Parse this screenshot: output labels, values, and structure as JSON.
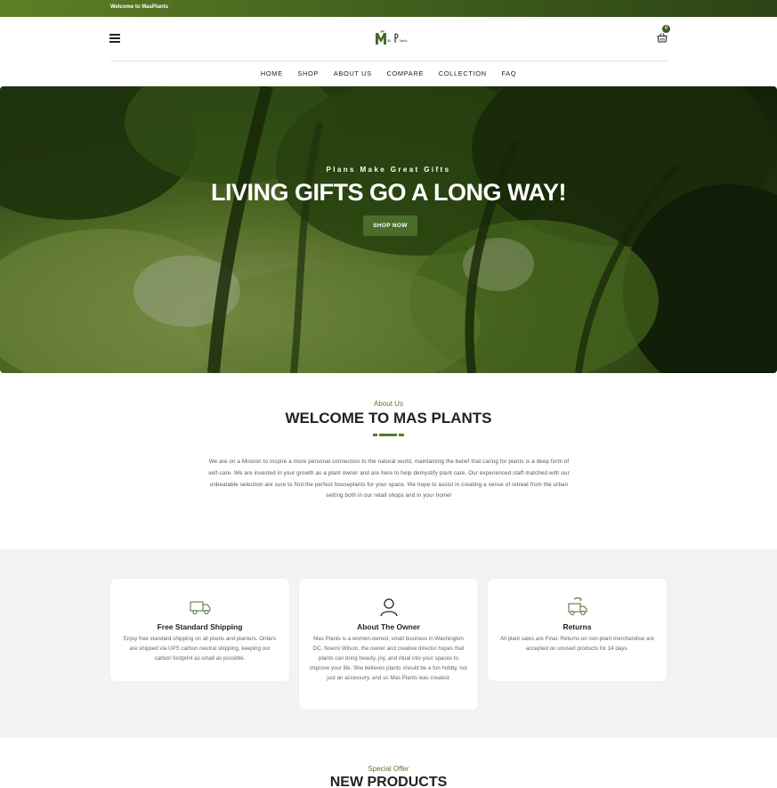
{
  "topbar": {
    "welcome": "Welcome to MasPlants"
  },
  "header": {
    "logo_text": "Mas Plants",
    "cart_count": "0"
  },
  "nav": {
    "items": [
      "HOME",
      "SHOP",
      "ABOUT US",
      "COMPARE",
      "COLLECTION",
      "FAQ"
    ]
  },
  "hero": {
    "subtitle": "Plans Make Great Gifts",
    "title": "LIVING GIFTS GO A LONG WAY!",
    "button": "SHOP NOW"
  },
  "about": {
    "label": "About Us",
    "title": "WELCOME TO MAS PLANTS",
    "text": "We are on a Mission to inspire a more personal connection to the natural world, maintaining the belief that caring for plants is a deep form of self-care. We are invested in your growth as a plant owner and are here to help demystify plant care. Our experienced staff matched with our unbeatable selection are sure to find the perfect houseplants for your space. We hope to assist in creating a sense of retreat from the urban setting both in our retail shops and in your home!"
  },
  "features": [
    {
      "icon": "truck-icon",
      "title": "Free Standard Shipping",
      "text": "Enjoy free standard shipping on all plants and planters. Orders are shipped via UPS carbon neutral shipping, keeping our carbon footprint as small as possible."
    },
    {
      "icon": "user-icon",
      "title": "About The Owner",
      "text": "Mas Plants is a women-owned, small business in Washington DC. Noemi Wilson, the owner and creative director hopes that plants can bring beauty, joy, and ritual into your spaces to improve your life. She believes plants should be a fun hobby, not just an accessory, and so Mas Plants was created."
    },
    {
      "icon": "return-truck-icon",
      "title": "Returns",
      "text": "All plant sales are Final. Returns on non-plant merchandise are accepted on unused products for 14 days."
    }
  ],
  "products": {
    "label": "Special Offer",
    "title": "NEW PRODUCTS"
  },
  "colors": {
    "brand_green": "#4a6d2c",
    "accent_green": "#5a7a26",
    "topbar_dark": "#2b4416"
  }
}
